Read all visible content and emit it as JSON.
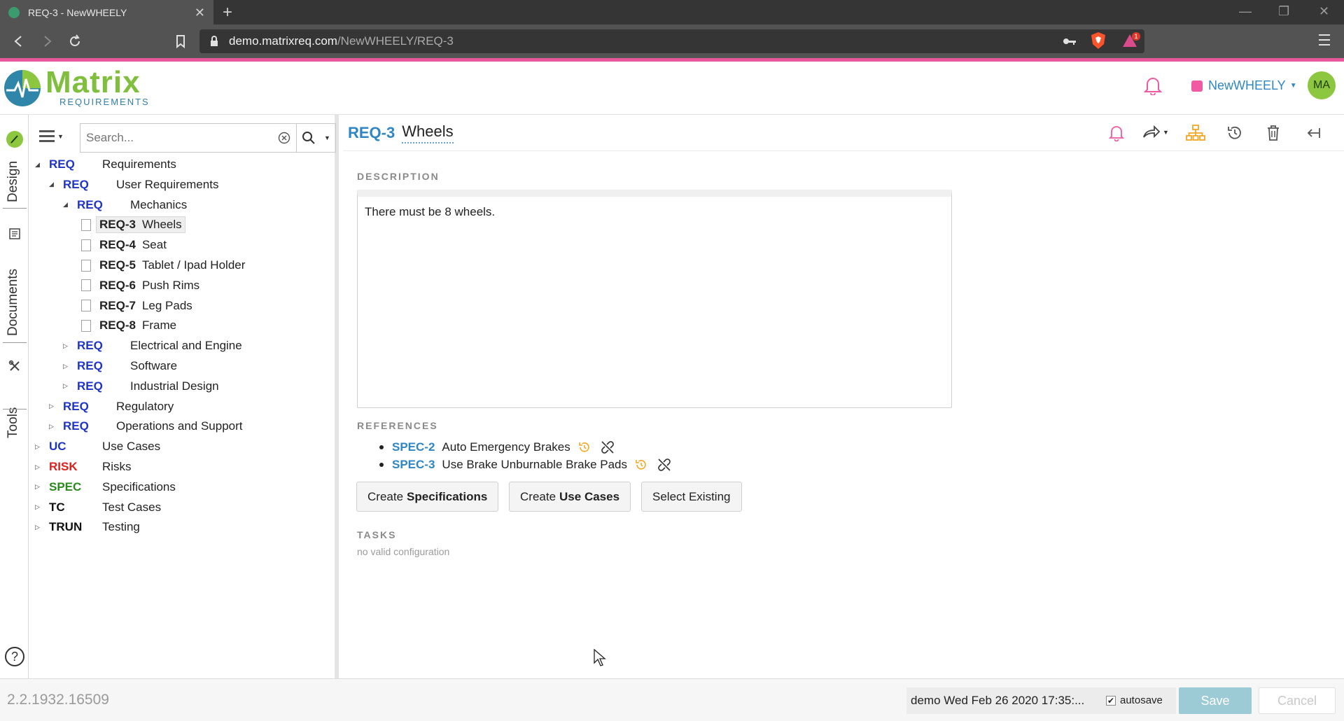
{
  "browser": {
    "tab_title": "REQ-3 - NewWHEELY",
    "url_host": "demo.matrixreq.com",
    "url_path": "/NewWHEELY/REQ-3",
    "brave_badge": "1"
  },
  "header": {
    "logo_main": "Matrix",
    "logo_sub": "REQUIREMENTS",
    "project": "NewWHEELY",
    "avatar": "MA"
  },
  "rail": [
    {
      "label": "Design",
      "icon": "brush-icon"
    },
    {
      "label": "Documents",
      "icon": "document-icon"
    },
    {
      "label": "Tools",
      "icon": "tools-icon"
    }
  ],
  "tree": {
    "search_placeholder": "Search...",
    "nodes": [
      {
        "level": 0,
        "toggle": "open",
        "cat": "REQ",
        "color": "#1e34c8",
        "label": "Requirements"
      },
      {
        "level": 1,
        "toggle": "open",
        "cat": "REQ",
        "color": "#1e34c8",
        "label": "User Requirements"
      },
      {
        "level": 2,
        "toggle": "open",
        "cat": "REQ",
        "color": "#1e34c8",
        "label": "Mechanics"
      },
      {
        "level": 3,
        "item": true,
        "id": "REQ-3",
        "label": "Wheels",
        "selected": true
      },
      {
        "level": 3,
        "item": true,
        "id": "REQ-4",
        "label": "Seat"
      },
      {
        "level": 3,
        "item": true,
        "id": "REQ-5",
        "label": "Tablet / Ipad Holder"
      },
      {
        "level": 3,
        "item": true,
        "id": "REQ-6",
        "label": "Push Rims"
      },
      {
        "level": 3,
        "item": true,
        "id": "REQ-7",
        "label": "Leg Pads"
      },
      {
        "level": 3,
        "item": true,
        "id": "REQ-8",
        "label": "Frame"
      },
      {
        "level": 2,
        "toggle": "closed",
        "cat": "REQ",
        "color": "#1e34c8",
        "label": "Electrical and Engine"
      },
      {
        "level": 2,
        "toggle": "closed",
        "cat": "REQ",
        "color": "#1e34c8",
        "label": "Software"
      },
      {
        "level": 2,
        "toggle": "closed",
        "cat": "REQ",
        "color": "#1e34c8",
        "label": "Industrial Design"
      },
      {
        "level": 1,
        "toggle": "closed",
        "cat": "REQ",
        "color": "#1e34c8",
        "label": "Regulatory"
      },
      {
        "level": 1,
        "toggle": "closed",
        "cat": "REQ",
        "color": "#1e34c8",
        "label": "Operations and Support"
      },
      {
        "level": 0,
        "toggle": "closed",
        "cat": "UC",
        "color": "#1e34c8",
        "label": "Use Cases"
      },
      {
        "level": 0,
        "toggle": "closed",
        "cat": "RISK",
        "color": "#e0201c",
        "label": "Risks"
      },
      {
        "level": 0,
        "toggle": "closed",
        "cat": "SPEC",
        "color": "#2a8a1e",
        "label": "Specifications"
      },
      {
        "level": 0,
        "toggle": "closed",
        "cat": "TC",
        "color": "#111111",
        "label": "Test Cases"
      },
      {
        "level": 0,
        "toggle": "closed",
        "cat": "TRUN",
        "color": "#111111",
        "label": "Testing"
      }
    ]
  },
  "item": {
    "id": "REQ-3",
    "title": "Wheels",
    "description_label": "DESCRIPTION",
    "description": "There must be 8 wheels.",
    "references_label": "REFERENCES",
    "references": [
      {
        "id": "SPEC-2",
        "label": "Auto Emergency Brakes"
      },
      {
        "id": "SPEC-3",
        "label": "Use Brake Unburnable Brake Pads"
      }
    ],
    "buttons": {
      "create_spec_prefix": "Create",
      "create_spec_bold": "Specifications",
      "create_uc_prefix": "Create",
      "create_uc_bold": "Use Cases",
      "select_existing": "Select Existing"
    },
    "tasks_label": "TASKS",
    "tasks_text": "no valid configuration"
  },
  "footer": {
    "version": "2.2.1932.16509",
    "save_status": "demo Wed Feb 26 2020 17:35:...",
    "autosave_label": "autosave",
    "save": "Save",
    "cancel": "Cancel"
  }
}
